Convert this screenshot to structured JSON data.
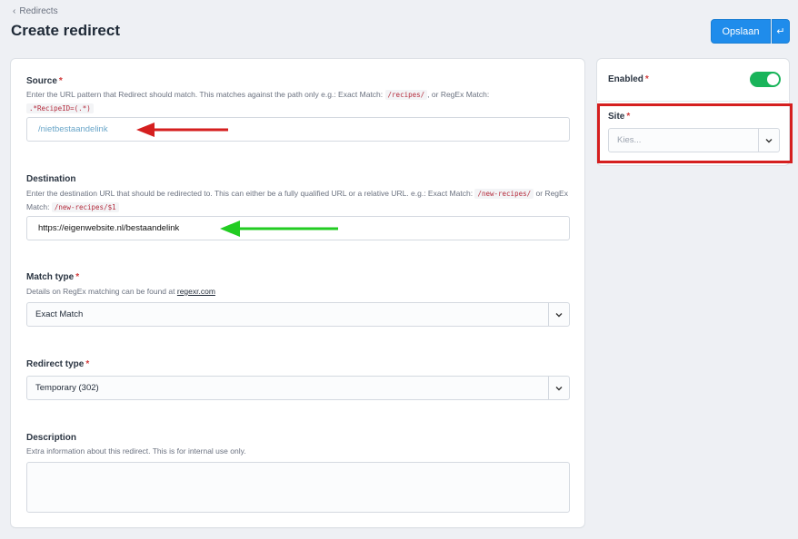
{
  "breadcrumb": {
    "label": "Redirects"
  },
  "page": {
    "title": "Create redirect"
  },
  "toolbar": {
    "save_label": "Opslaan",
    "return_symbol": "↵"
  },
  "source": {
    "label": "Source",
    "help_prefix": "Enter the URL pattern that Redirect should match. This matches against the path only e.g.: Exact Match:",
    "help_code1": "/recipes/",
    "help_mid": ", or RegEx Match:",
    "help_code2": ".*RecipeID=(.*)",
    "value": "/nietbestaandelink"
  },
  "destination": {
    "label": "Destination",
    "help_prefix": "Enter the destination URL that should be redirected to. This can either be a fully qualified URL or a relative URL. e.g.: Exact Match:",
    "help_code1": "/new-recipes/",
    "help_mid": "or RegEx Match:",
    "help_code2": "/new-recipes/$1",
    "value": "https://eigenwebsite.nl/bestaandelink"
  },
  "match_type": {
    "label": "Match type",
    "help_prefix": "Details on RegEx matching can be found at",
    "help_link": "regexr.com",
    "value": "Exact Match"
  },
  "redirect_type": {
    "label": "Redirect type",
    "value": "Temporary (302)"
  },
  "description": {
    "label": "Description",
    "help": "Extra information about this redirect. This is for internal use only."
  },
  "sidebar": {
    "enabled_label": "Enabled",
    "enabled": true,
    "site_label": "Site",
    "site_placeholder": "Kies..."
  },
  "required_mark": "*",
  "colors": {
    "primary": "#1f8ceb",
    "toggle_on": "#19b45a",
    "annotation_red": "#d51f1f",
    "annotation_green": "#22cc22",
    "required": "#d23b3b"
  }
}
